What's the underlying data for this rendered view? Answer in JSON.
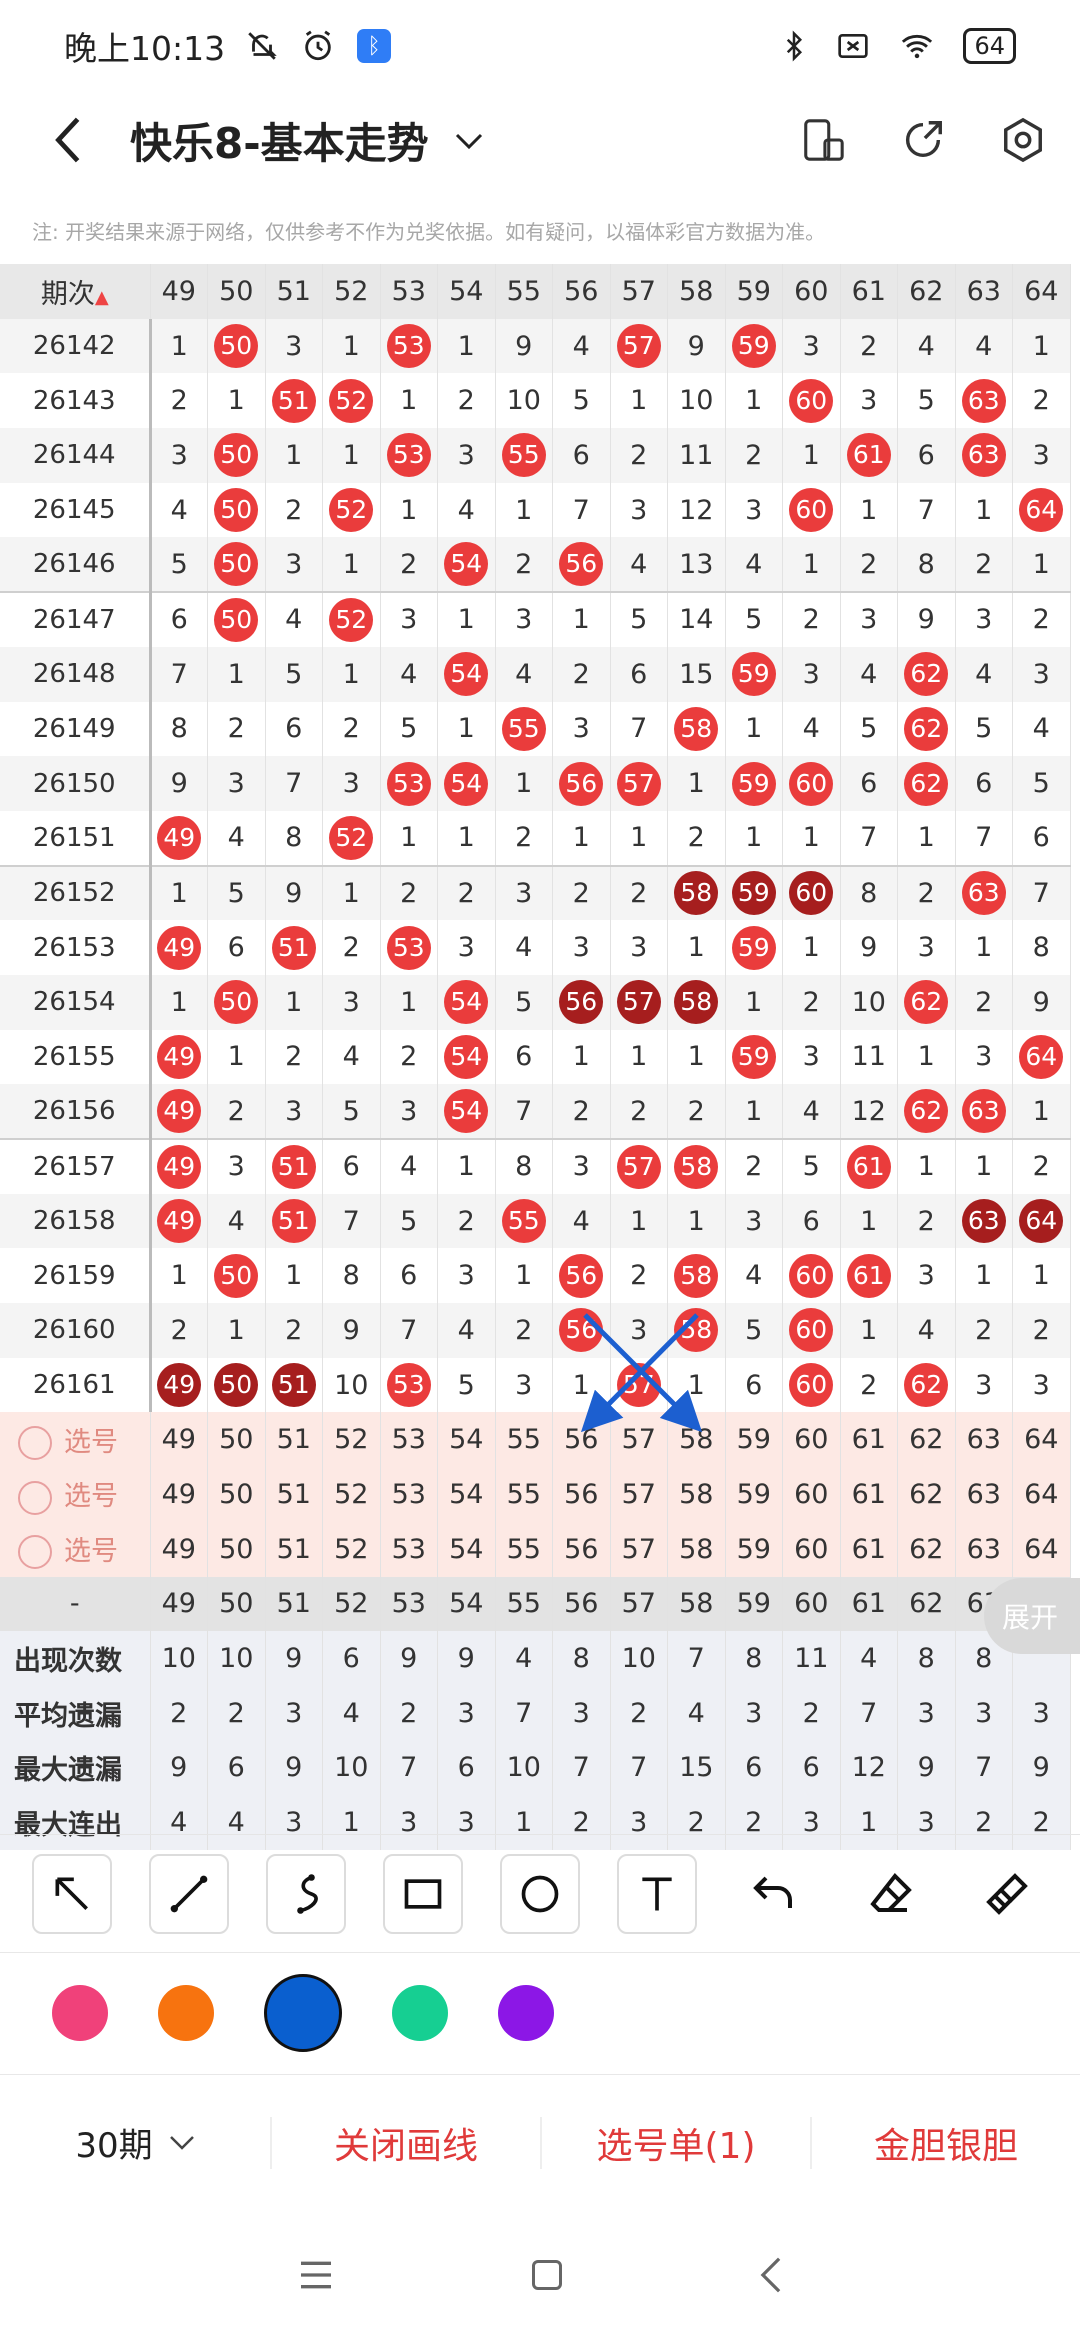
{
  "status": {
    "time": "晚上10:13",
    "battery": "64"
  },
  "appbar": {
    "title": "快乐8-基本走势"
  },
  "notice": "注: 开奖结果来源于网络，仅供参考不作为兑奖依据。如有疑问，以福体彩官方数据为准。",
  "table": {
    "period_header": "期次",
    "columns": [
      "49",
      "50",
      "51",
      "52",
      "53",
      "54",
      "55",
      "56",
      "57",
      "58",
      "59",
      "60",
      "61",
      "62",
      "63",
      "64"
    ],
    "rows": [
      {
        "period": "26142",
        "cells": [
          "1",
          "50",
          "3",
          "1",
          "53",
          "1",
          "9",
          "4",
          "57",
          "9",
          "59",
          "3",
          "2",
          "4",
          "4",
          "1"
        ]
      },
      {
        "period": "26143",
        "cells": [
          "2",
          "1",
          "51",
          "52",
          "1",
          "2",
          "10",
          "5",
          "1",
          "10",
          "1",
          "60",
          "3",
          "5",
          "63",
          "2"
        ]
      },
      {
        "period": "26144",
        "cells": [
          "3",
          "50",
          "1",
          "1",
          "53",
          "3",
          "55",
          "6",
          "2",
          "11",
          "2",
          "1",
          "61",
          "6",
          "63",
          "3"
        ]
      },
      {
        "period": "26145",
        "cells": [
          "4",
          "50",
          "2",
          "52",
          "1",
          "4",
          "1",
          "7",
          "3",
          "12",
          "3",
          "60",
          "1",
          "7",
          "1",
          "64"
        ]
      },
      {
        "period": "26146",
        "cells": [
          "5",
          "50",
          "3",
          "1",
          "2",
          "54",
          "2",
          "56",
          "4",
          "13",
          "4",
          "1",
          "2",
          "8",
          "2",
          "1"
        ]
      },
      {
        "period": "26147",
        "cells": [
          "6",
          "50",
          "4",
          "52",
          "3",
          "1",
          "3",
          "1",
          "5",
          "14",
          "5",
          "2",
          "3",
          "9",
          "3",
          "2"
        ]
      },
      {
        "period": "26148",
        "cells": [
          "7",
          "1",
          "5",
          "1",
          "4",
          "54",
          "4",
          "2",
          "6",
          "15",
          "59",
          "3",
          "4",
          "62",
          "4",
          "3"
        ]
      },
      {
        "period": "26149",
        "cells": [
          "8",
          "2",
          "6",
          "2",
          "5",
          "1",
          "55",
          "3",
          "7",
          "58",
          "1",
          "4",
          "5",
          "62",
          "5",
          "4"
        ]
      },
      {
        "period": "26150",
        "cells": [
          "9",
          "3",
          "7",
          "3",
          "53",
          "54",
          "1",
          "56",
          "57",
          "1",
          "59",
          "60",
          "6",
          "62",
          "6",
          "5"
        ]
      },
      {
        "period": "26151",
        "cells": [
          "49",
          "4",
          "8",
          "52",
          "1",
          "1",
          "2",
          "1",
          "1",
          "2",
          "1",
          "1",
          "7",
          "1",
          "7",
          "6"
        ]
      },
      {
        "period": "26152",
        "cells": [
          "1",
          "5",
          "9",
          "1",
          "2",
          "2",
          "3",
          "2",
          "2",
          "58",
          "59",
          "60",
          "8",
          "2",
          "63",
          "7"
        ]
      },
      {
        "period": "26153",
        "cells": [
          "49",
          "6",
          "51",
          "2",
          "53",
          "3",
          "4",
          "3",
          "3",
          "1",
          "59",
          "1",
          "9",
          "3",
          "1",
          "8"
        ]
      },
      {
        "period": "26154",
        "cells": [
          "1",
          "50",
          "1",
          "3",
          "1",
          "54",
          "5",
          "56",
          "57",
          "58",
          "1",
          "2",
          "10",
          "62",
          "2",
          "9"
        ]
      },
      {
        "period": "26155",
        "cells": [
          "49",
          "1",
          "2",
          "4",
          "2",
          "54",
          "6",
          "1",
          "1",
          "1",
          "59",
          "3",
          "11",
          "1",
          "3",
          "64"
        ]
      },
      {
        "period": "26156",
        "cells": [
          "49",
          "2",
          "3",
          "5",
          "3",
          "54",
          "7",
          "2",
          "2",
          "2",
          "1",
          "4",
          "12",
          "62",
          "63",
          "1"
        ]
      },
      {
        "period": "26157",
        "cells": [
          "49",
          "3",
          "51",
          "6",
          "4",
          "1",
          "8",
          "3",
          "57",
          "58",
          "2",
          "5",
          "61",
          "1",
          "1",
          "2"
        ]
      },
      {
        "period": "26158",
        "cells": [
          "49",
          "4",
          "51",
          "7",
          "5",
          "2",
          "55",
          "4",
          "1",
          "1",
          "3",
          "6",
          "1",
          "2",
          "63",
          "64"
        ]
      },
      {
        "period": "26159",
        "cells": [
          "1",
          "50",
          "1",
          "8",
          "6",
          "3",
          "1",
          "56",
          "2",
          "58",
          "4",
          "60",
          "61",
          "3",
          "1",
          "1"
        ]
      },
      {
        "period": "26160",
        "cells": [
          "2",
          "1",
          "2",
          "9",
          "7",
          "4",
          "2",
          "56",
          "3",
          "58",
          "5",
          "60",
          "1",
          "4",
          "2",
          "2"
        ]
      },
      {
        "period": "26161",
        "cells": [
          "49",
          "50",
          "51",
          "10",
          "53",
          "5",
          "3",
          "1",
          "57",
          "1",
          "6",
          "60",
          "2",
          "62",
          "3",
          "3"
        ]
      }
    ],
    "select_label": "选号",
    "axis_label": "-",
    "stats": [
      {
        "label": "出现次数",
        "values": [
          "10",
          "10",
          "9",
          "6",
          "9",
          "9",
          "4",
          "8",
          "10",
          "7",
          "8",
          "11",
          "4",
          "8",
          "8",
          ""
        ]
      },
      {
        "label": "平均遗漏",
        "values": [
          "2",
          "2",
          "3",
          "4",
          "2",
          "3",
          "7",
          "3",
          "2",
          "4",
          "3",
          "2",
          "7",
          "3",
          "3",
          "3"
        ]
      },
      {
        "label": "最大遗漏",
        "values": [
          "9",
          "6",
          "9",
          "10",
          "7",
          "6",
          "10",
          "7",
          "7",
          "15",
          "6",
          "6",
          "12",
          "9",
          "7",
          "9"
        ]
      },
      {
        "label": "最大连出",
        "values": [
          "4",
          "4",
          "3",
          "1",
          "3",
          "3",
          "1",
          "2",
          "3",
          "2",
          "2",
          "3",
          "1",
          "3",
          "2",
          "2"
        ]
      }
    ],
    "expand_label": "展开"
  },
  "colors": {
    "pink": "#f0417a",
    "orange": "#f7730f",
    "blue": "#0a5fcf",
    "green": "#16cf92",
    "purple": "#8c17e6"
  },
  "bottom": {
    "period": "30期",
    "close_line": "关闭画线",
    "select_list": "选号单(1)",
    "gold_silver": "金胆银胆"
  }
}
